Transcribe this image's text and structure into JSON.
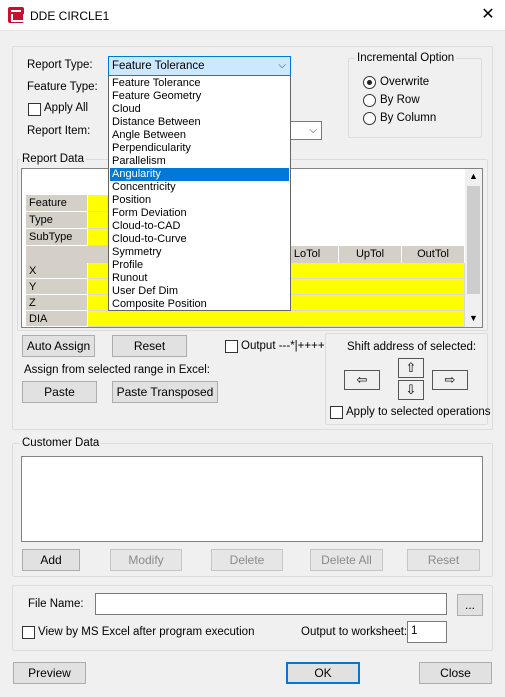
{
  "window": {
    "title": "DDE CIRCLE1",
    "close_glyph": "✕"
  },
  "report": {
    "report_type_label": "Report Type:",
    "report_type_value": "Feature Tolerance",
    "feature_type_label": "Feature Type:",
    "apply_all_label": "Apply All",
    "report_item_label": "Report Item:",
    "dropdown_options": [
      "Feature Tolerance",
      "Feature Geometry",
      "Cloud",
      "Distance Between",
      "Angle Between",
      "Perpendicularity",
      "Parallelism",
      "Angularity",
      "Concentricity",
      "Position",
      "Form Deviation",
      "Cloud-to-CAD",
      "Cloud-to-Curve",
      "Symmetry",
      "Profile",
      "Runout",
      "User Def Dim",
      "Composite Position"
    ],
    "dropdown_selected_index": 7
  },
  "incremental": {
    "group_label": "Incremental Option",
    "options": [
      "Overwrite",
      "By Row",
      "By Column"
    ],
    "selected": 0
  },
  "report_data": {
    "group_label": "Report Data",
    "row_headers_top": [
      "Feature",
      "Type",
      "SubType"
    ],
    "col_headers": [
      "LoTol",
      "UpTol",
      "OutTol"
    ],
    "row_headers": [
      "X",
      "Y",
      "Z",
      "DIA"
    ]
  },
  "actions": {
    "auto_assign": "Auto Assign",
    "reset": "Reset",
    "output_label": "Output ---*|++++",
    "assign_from_excel": "Assign from selected range in Excel:",
    "paste": "Paste",
    "paste_transposed": "Paste Transposed"
  },
  "shift": {
    "label": "Shift address of selected:",
    "apply_selected": "Apply to selected operations"
  },
  "customer": {
    "group_label": "Customer Data",
    "add": "Add",
    "modify": "Modify",
    "delete": "Delete",
    "delete_all": "Delete All",
    "reset": "Reset"
  },
  "file": {
    "file_name_label": "File Name:",
    "file_name_value": "",
    "browse": "...",
    "view_excel_label": "View by MS Excel after program execution",
    "output_worksheet_label": "Output to worksheet:",
    "output_worksheet_value": "1"
  },
  "footer": {
    "preview": "Preview",
    "ok": "OK",
    "close": "Close"
  }
}
